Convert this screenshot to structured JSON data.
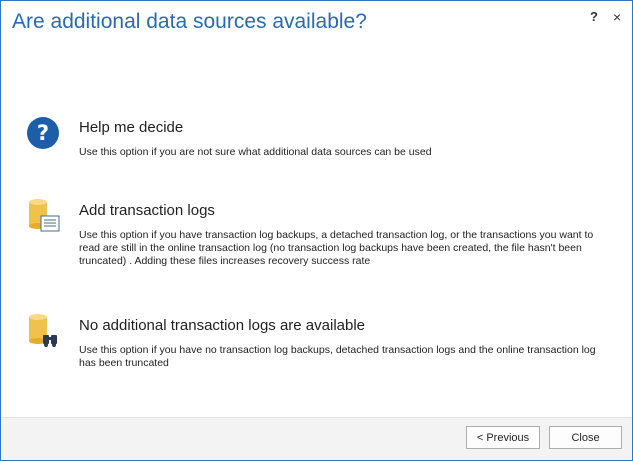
{
  "dialog": {
    "title": "Are additional data sources available?",
    "help_glyph": "?",
    "close_glyph": "×"
  },
  "options": [
    {
      "icon": "question-icon",
      "title": "Help me decide",
      "description": "Use this option if you are not sure what additional data sources can be used"
    },
    {
      "icon": "database-log-icon",
      "title": "Add transaction logs",
      "description": "Use this option if you have transaction log backups, a detached transaction log, or the transactions you want to read are still in the online transaction log (no transaction log backups have been created, the file hasn't been truncated) . Adding these files increases recovery success rate"
    },
    {
      "icon": "database-binoculars-icon",
      "title": "No additional transaction logs are available",
      "description": "Use this option if you have no transaction log backups, detached transaction logs and the online transaction log has been truncated"
    }
  ],
  "footer": {
    "previous_label": "< Previous",
    "close_label": "Close"
  },
  "colors": {
    "accent": "#2a6ab0",
    "border": "#2b79c2",
    "db_gold": "#f1c24b"
  }
}
